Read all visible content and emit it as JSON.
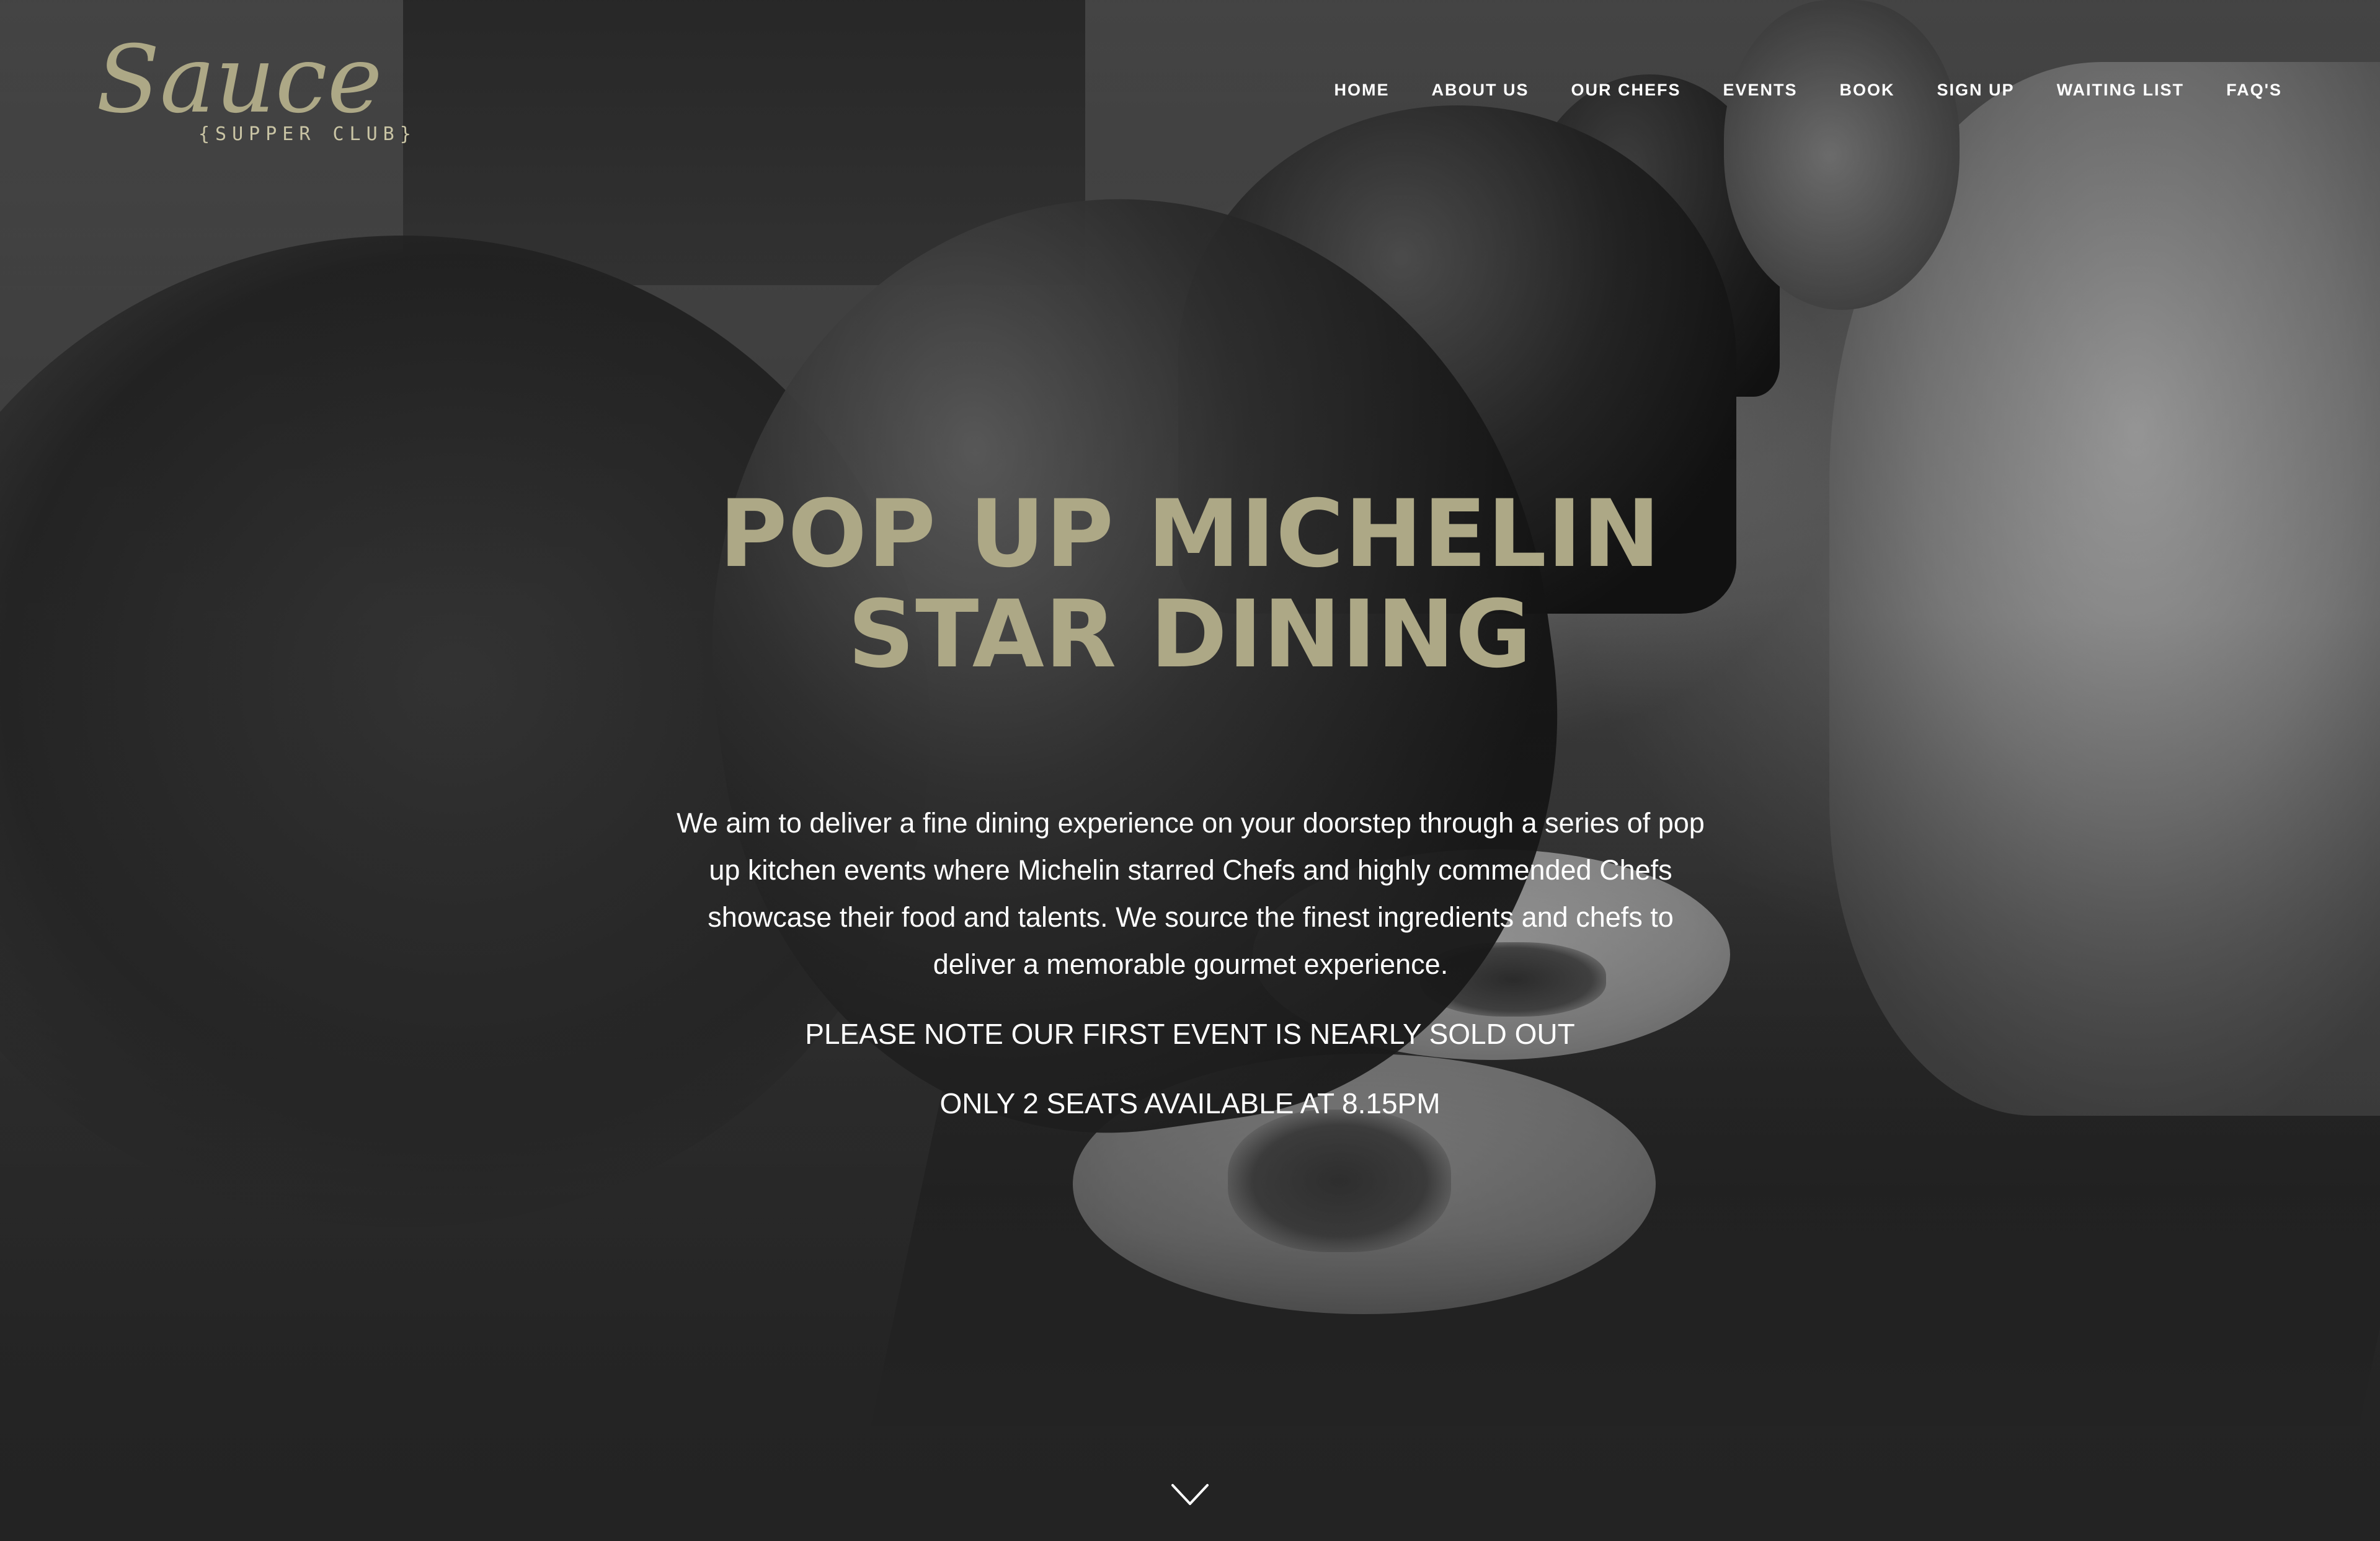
{
  "brand": {
    "logo_script": "Sauce",
    "logo_sub": "{SUPPER CLUB}",
    "logo_color": "#ada886"
  },
  "nav": {
    "items": [
      {
        "label": "HOME"
      },
      {
        "label": "ABOUT US"
      },
      {
        "label": "OUR CHEFS"
      },
      {
        "label": "EVENTS"
      },
      {
        "label": "BOOK"
      },
      {
        "label": "SIGN UP"
      },
      {
        "label": "WAITING LIST"
      },
      {
        "label": "FAQ'S"
      }
    ]
  },
  "hero": {
    "headline_line1": "POP UP MICHELIN",
    "headline_line2": "STAR DINING",
    "headline_color": "#ada886",
    "description": "We aim to deliver a fine dining experience on your doorstep through a series of pop up kitchen events where Michelin starred Chefs and highly commended Chefs showcase their food and talents. We source the finest ingredients and chefs to deliver a memorable gourmet experience.",
    "notice_1": "PLEASE NOTE OUR FIRST EVENT IS NEARLY SOLD OUT",
    "notice_2": "ONLY 2 SEATS AVAILABLE AT 8.15PM",
    "scroll_icon": "chevron-down-icon"
  }
}
